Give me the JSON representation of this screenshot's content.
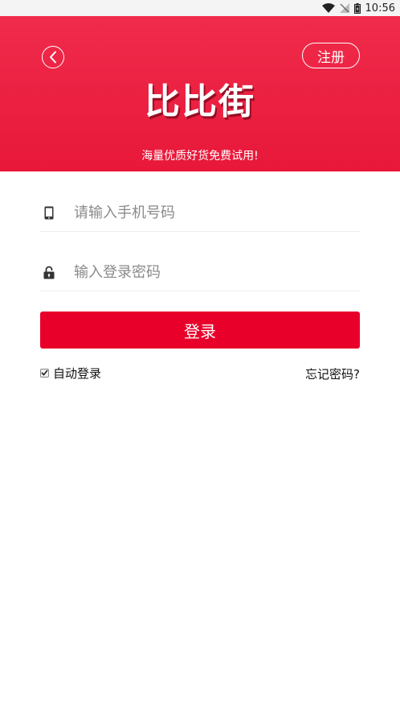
{
  "status_bar": {
    "time": "10:56"
  },
  "header": {
    "register_label": "注册",
    "app_title": "比比街",
    "slogan": "海量优质好货免费试用!"
  },
  "form": {
    "phone_placeholder": "请输入手机号码",
    "phone_value": "",
    "password_placeholder": "输入登录密码",
    "password_value": "",
    "login_label": "登录",
    "auto_login_label": "自动登录",
    "auto_login_checked": true,
    "forgot_label": "忘记密码?"
  },
  "colors": {
    "brand_red": "#e8183a",
    "button_red": "#e8002a"
  },
  "icons": {
    "back": "chevron-left-icon",
    "phone": "phone-icon",
    "lock": "lock-icon",
    "wifi": "wifi-icon",
    "signal": "signal-icon",
    "battery": "battery-icon"
  }
}
